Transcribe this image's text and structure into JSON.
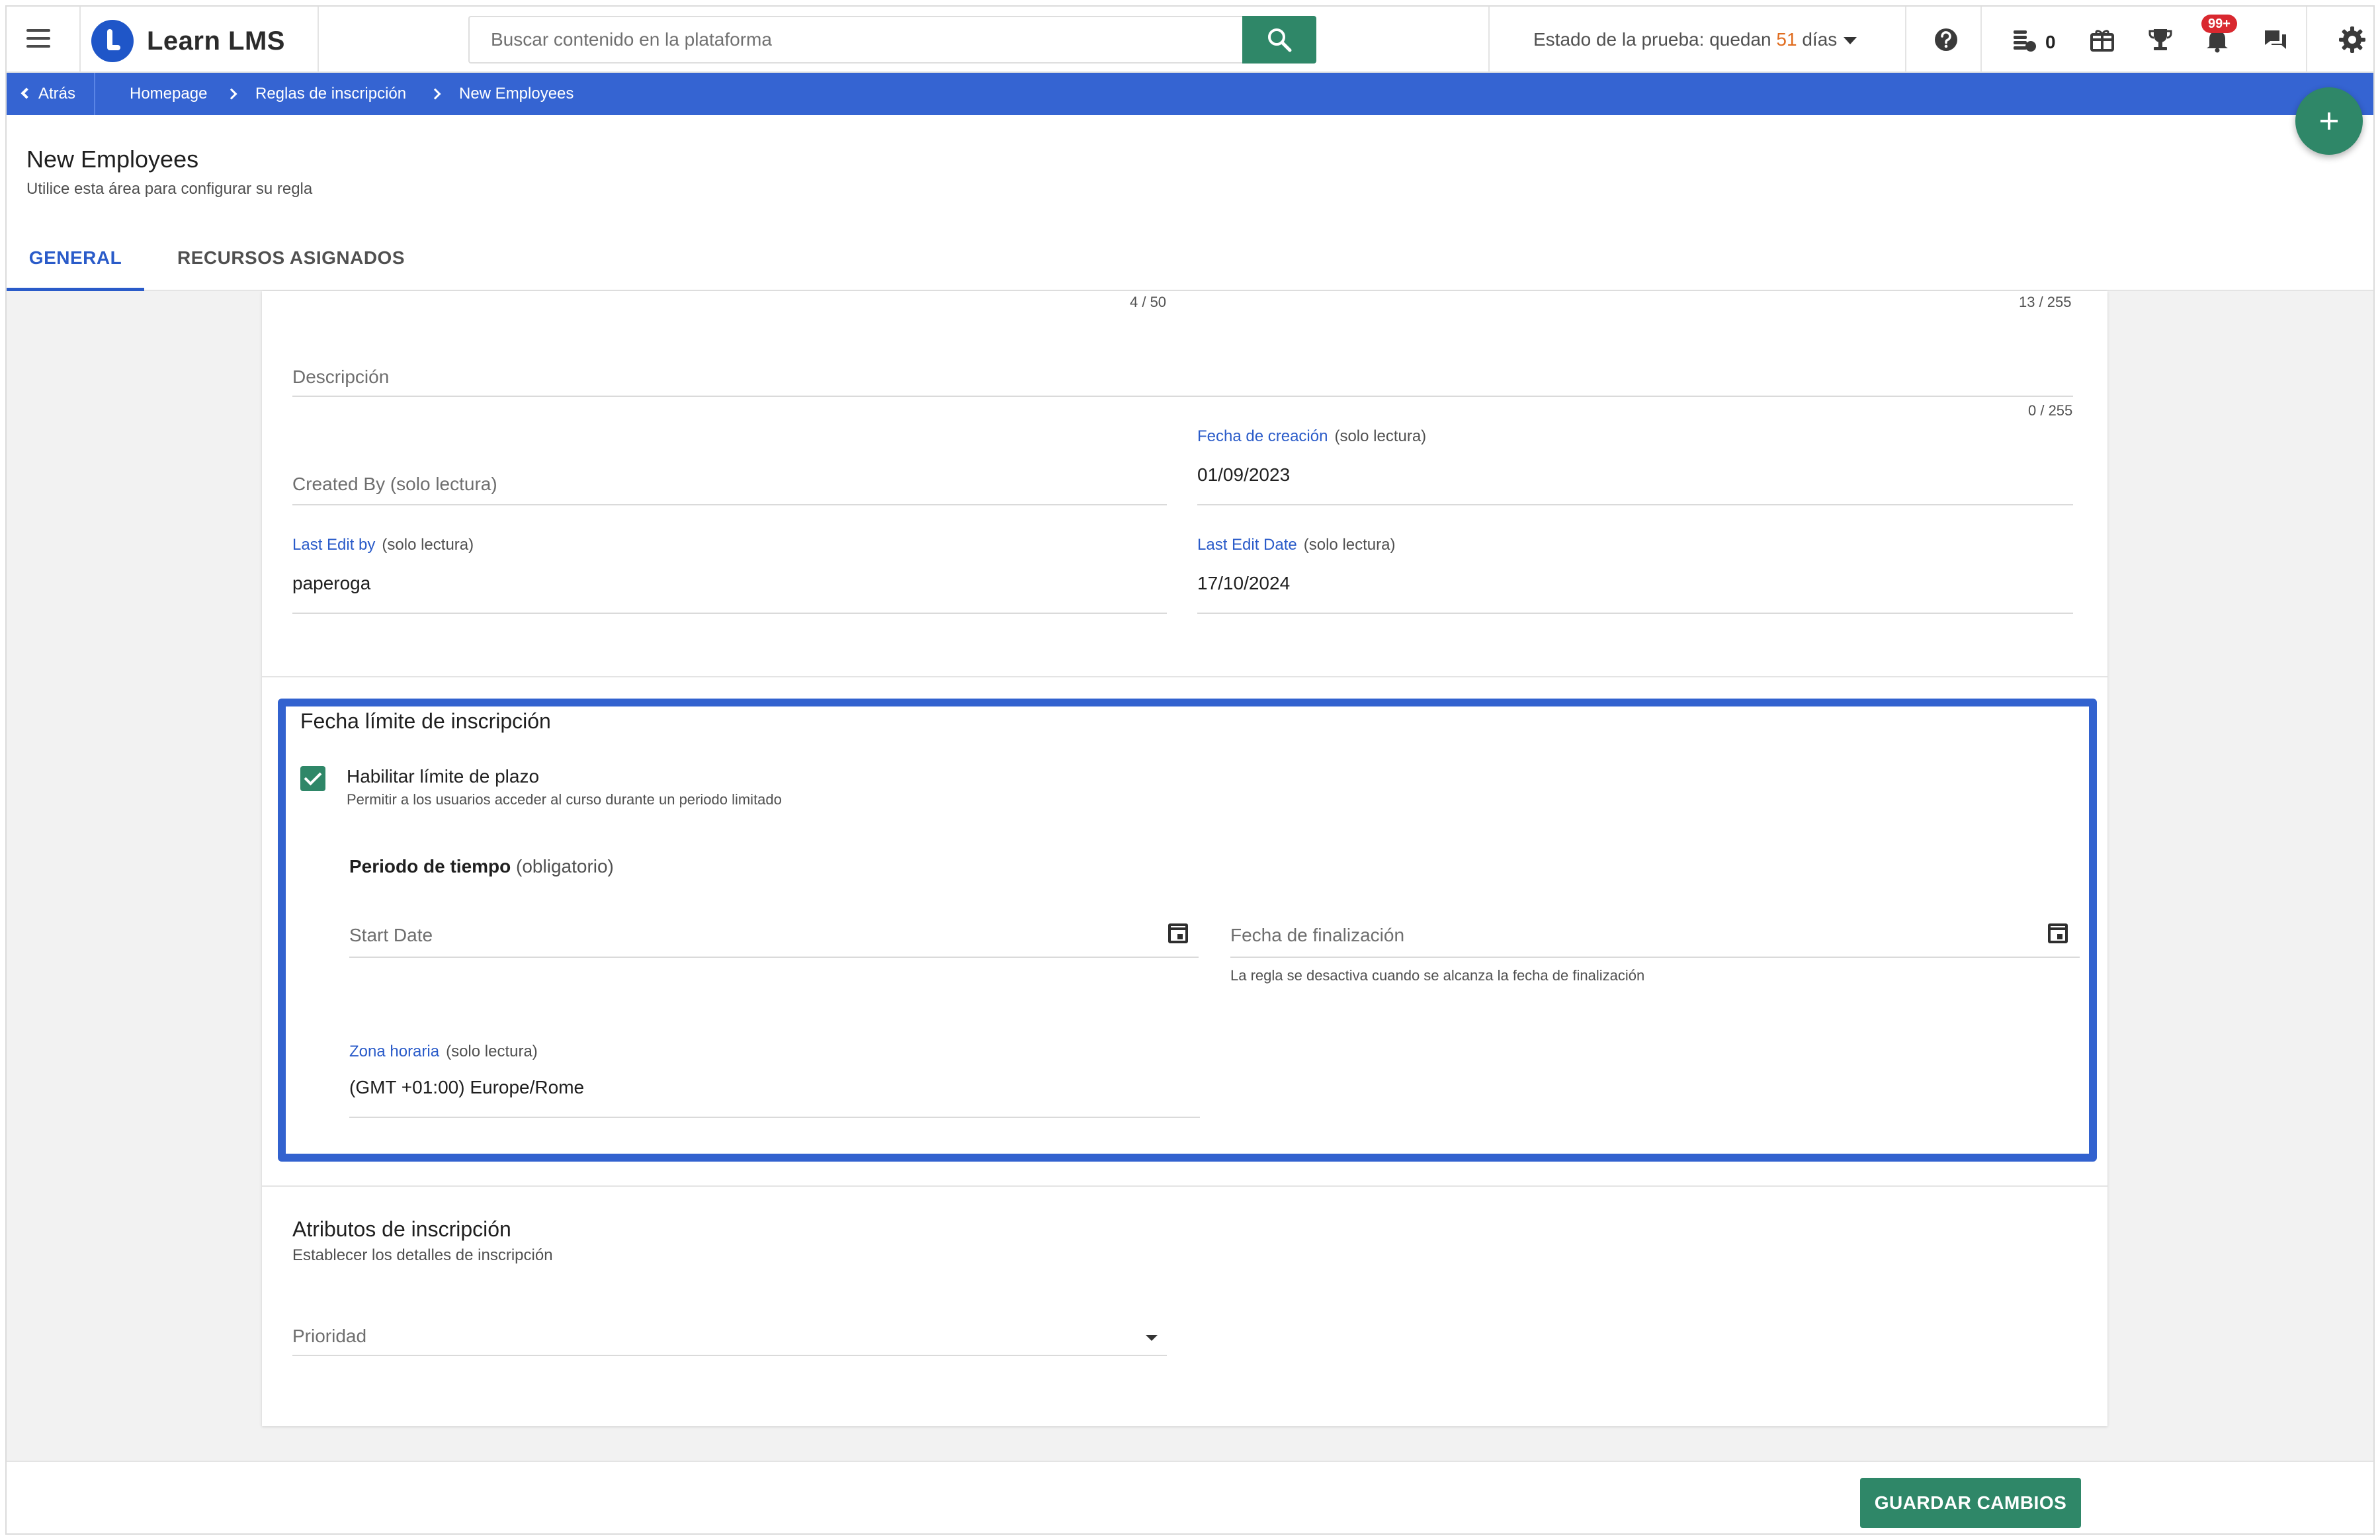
{
  "header": {
    "logo_text": "Learn LMS",
    "search_placeholder": "Buscar contenido en la plataforma",
    "trial_prefix": "Estado de la prueba: quedan ",
    "trial_days": "51",
    "trial_suffix": " días",
    "coins_count": "0",
    "notifications_badge": "99+"
  },
  "breadcrumb": {
    "back_label": "Atrás",
    "items": [
      "Homepage",
      "Reglas de inscripción",
      "New Employees"
    ]
  },
  "page": {
    "title": "New Employees",
    "subtitle": "Utilice esta área para configurar su regla",
    "tabs": [
      "GENERAL",
      "RECURSOS ASIGNADOS"
    ]
  },
  "form": {
    "name_counter": "4 / 50",
    "code_counter": "13 / 255",
    "description_placeholder": "Descripción",
    "description_counter": "0 / 255",
    "created_by_placeholder": "Created By",
    "read_only": "(solo lectura)",
    "creation_date_label": "Fecha de creación",
    "creation_date_value": "01/09/2023",
    "last_edit_by_label": "Last Edit by",
    "last_edit_by_value": "paperoga",
    "last_edit_date_label": "Last Edit Date",
    "last_edit_date_value": "17/10/2024"
  },
  "deadline": {
    "title": "Fecha límite de inscripción",
    "checkbox_label": "Habilitar límite de plazo",
    "checkbox_checked": true,
    "checkbox_hint": "Permitir a los usuarios acceder al curso durante un periodo limitado",
    "period_label": "Periodo de tiempo",
    "period_required": "(obligatorio)",
    "start_placeholder": "Start Date",
    "end_placeholder": "Fecha de finalización",
    "end_hint": "La regla se desactiva cuando se alcanza la fecha de finalización",
    "timezone_label": "Zona horaria",
    "timezone_value": "(GMT +01:00) Europe/Rome"
  },
  "attributes": {
    "title": "Atributos de inscripción",
    "subtitle": "Establecer los detalles de inscripción",
    "priority_placeholder": "Prioridad"
  },
  "footer": {
    "save_label": "GUARDAR CAMBIOS"
  },
  "colors": {
    "brand_blue": "#3564d2",
    "accent_green": "#2f8768",
    "highlight_border": "#3262cf",
    "trial_days": "#e06c1e",
    "badge_red": "#d9282f"
  }
}
